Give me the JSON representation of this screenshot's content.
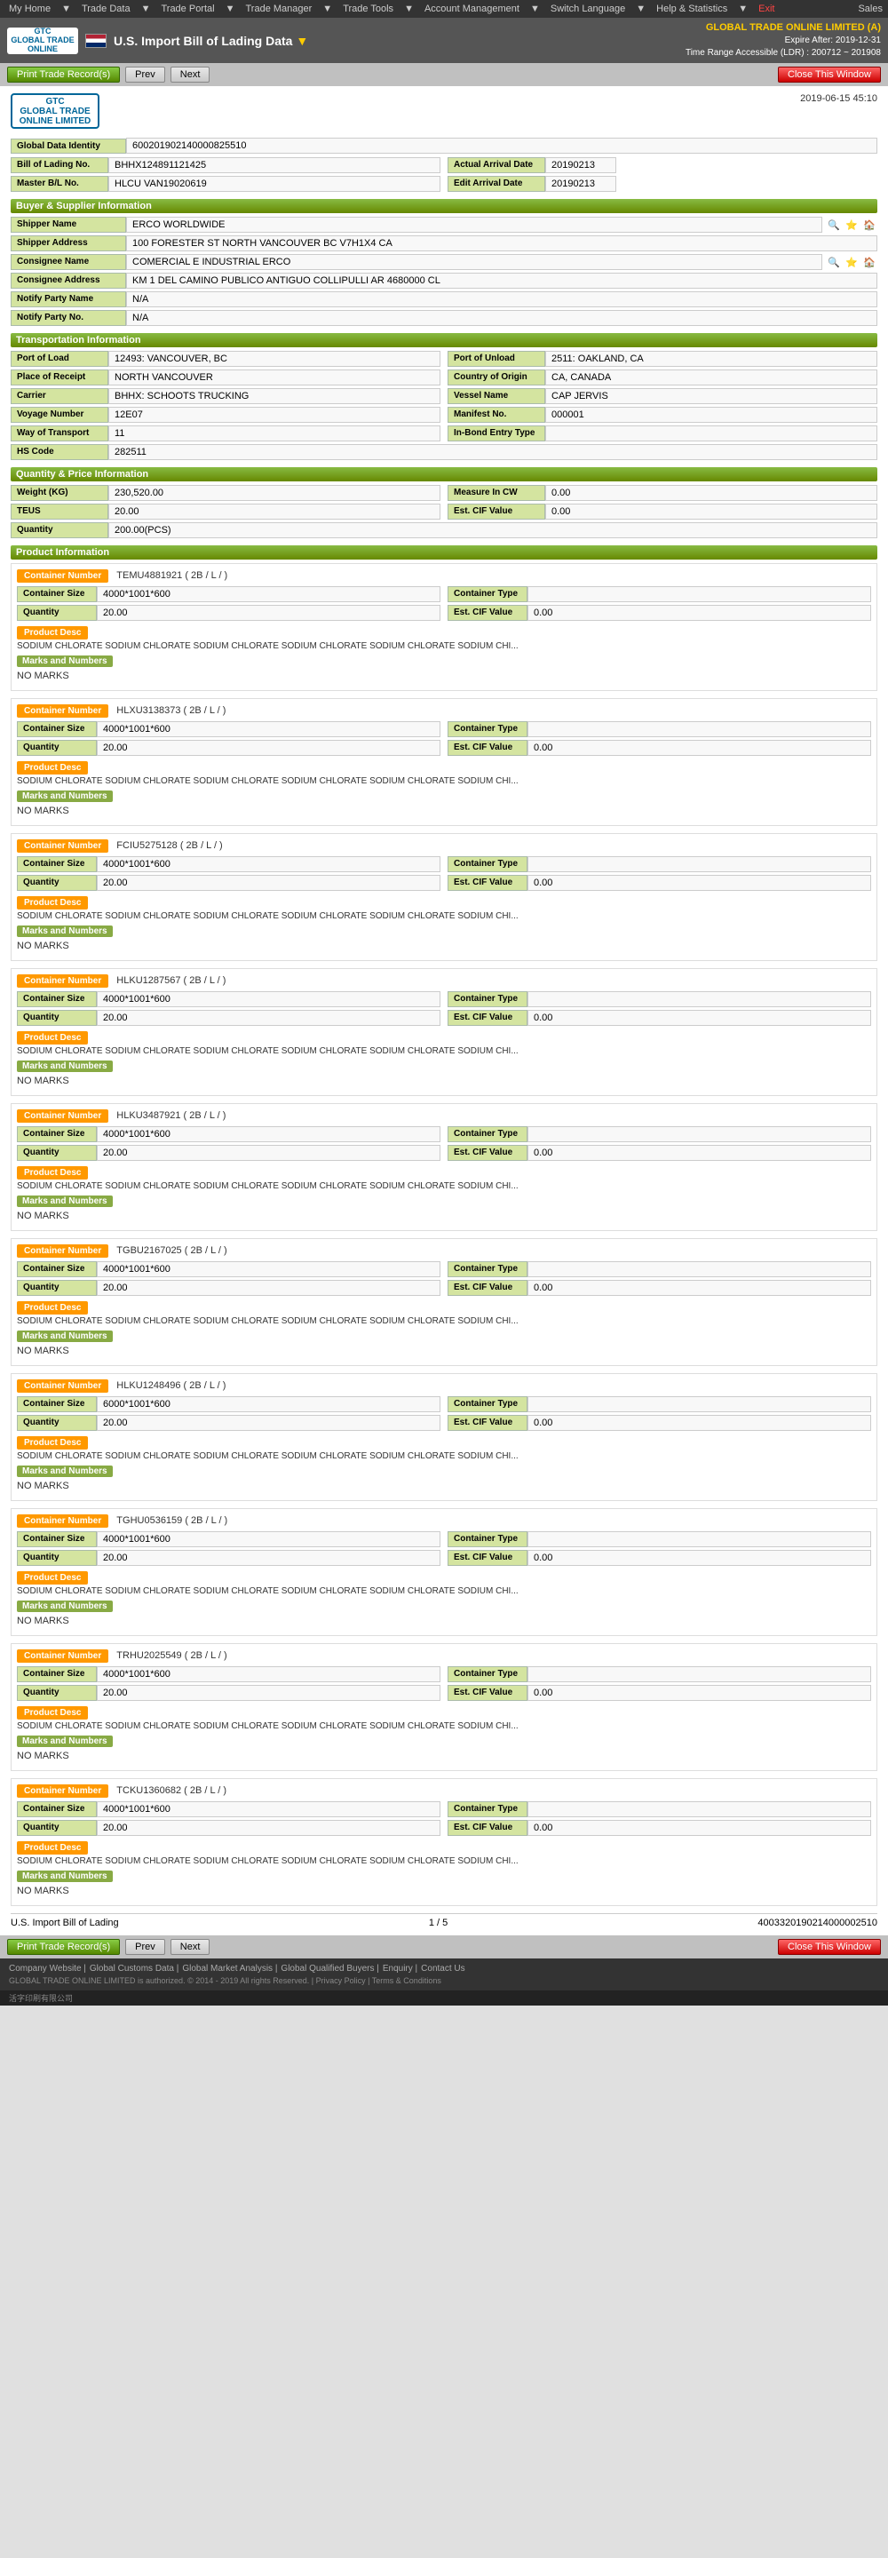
{
  "topnav": {
    "items": [
      "My Home",
      "Trade Data",
      "Trade Portal",
      "Trade Manager",
      "Trade Tools",
      "Account Management",
      "Switch Language",
      "Help & Statistics",
      "Exit"
    ],
    "sales": "Sales"
  },
  "header": {
    "logo_text": "GTC\nGLOBAL TRADE\nONLINE",
    "flag_alt": "US Flag",
    "title": "U.S. Import Bill of Lading Data",
    "company": "GLOBAL TRADE ONLINE LIMITED (A)",
    "expire": "Expire After: 2019-12-31",
    "time_range": "Time Range Accessible (LDR) : 200712 ~ 201908"
  },
  "controls": {
    "prev": "Prev",
    "next": "Next",
    "print": "Print Trade Record(s)",
    "close": "Close This Window"
  },
  "record": {
    "date": "2019-06-15 45:10",
    "global_data_id_label": "Global Data Identity",
    "global_data_id": "600201902140000825510",
    "bill_of_lading_label": "Bill of Lading No.",
    "bill_of_lading": "BHHX124891121425",
    "actual_arrival_date_label": "Actual Arrival Date",
    "actual_arrival_date": "20190213",
    "master_bol_label": "Master B/L No.",
    "master_bol": "HLCU VAN19020619",
    "edit_arrival_date_label": "Edit Arrival Date",
    "edit_arrival_date": "20190213"
  },
  "buyer_supplier": {
    "section_label": "Buyer & Supplier Information",
    "shipper_name_label": "Shipper Name",
    "shipper_name": "ERCO WORLDWIDE",
    "shipper_address_label": "Shipper Address",
    "shipper_address": "100 FORESTER ST NORTH VANCOUVER BC V7H1X4 CA",
    "consignee_label": "Consignee Name",
    "consignee": "COMERCIAL E INDUSTRIAL ERCO",
    "consignee_address_label": "Consignee Address",
    "consignee_address": "KM 1 DEL CAMINO PUBLICO ANTIGUO COLLIPULLI AR 4680000 CL",
    "notify_party_label": "Notify Party Name",
    "notify_party": "N/A",
    "notify_party2_label": "Notify Party No.",
    "notify_party2": "N/A"
  },
  "transportation": {
    "section_label": "Transportation Information",
    "port_of_load_label": "Port of Load",
    "port_of_load": "12493: VANCOUVER, BC",
    "port_of_unlaid_label": "Port of Unload",
    "port_of_unlaid": "2511: OAKLAND, CA",
    "place_of_receipt_label": "Place of Receipt",
    "place_of_receipt": "NORTH VANCOUVER",
    "country_of_origin_label": "Country of Origin",
    "country_of_origin": "CA, CANADA",
    "carrier_label": "Carrier",
    "carrier": "BHHX: SCHOOTS TRUCKING",
    "vessel_name_label": "Vessel Name",
    "vessel_name": "CAP JERVIS",
    "voyage_number_label": "Voyage Number",
    "voyage_number": "12E07",
    "manifest_no_label": "Manifest No.",
    "manifest_no": "000001",
    "way_of_transport_label": "Way of Transport",
    "way_of_transport": "11",
    "in_bond_entry_label": "In-Bond Entry Type",
    "in_bond_entry": "",
    "hs_code_label": "HS Code",
    "hs_code": "282511"
  },
  "quantity_price": {
    "section_label": "Quantity & Price Information",
    "weight_label": "Weight (KG)",
    "weight": "230,520.00",
    "measure_label": "Measure In CW",
    "measure": "0.00",
    "teus_label": "TEUS",
    "teus": "20.00",
    "est_cif_label": "Est. CIF Value",
    "est_cif": "0.00",
    "quantity_label": "Quantity",
    "quantity": "200.00(PCS)"
  },
  "product_info": {
    "section_label": "Product Information"
  },
  "containers": [
    {
      "id": "C1",
      "number_label": "Container Number",
      "number": "TEMU4881921 ( 2B / L / )",
      "size_label": "Container Size",
      "size": "4000*1001*600",
      "type_label": "Container Type",
      "type": "",
      "qty_label": "Quantity",
      "qty": "20.00",
      "est_cif_label": "Est. CIF Value",
      "est_cif": "0.00",
      "product_desc_label": "Product Desc",
      "product_desc": "SODIUM CHLORATE SODIUM CHLORATE SODIUM CHLORATE SODIUM CHLORATE SODIUM CHLORATE SODIUM CHI...",
      "marks_label": "Marks and Numbers",
      "marks": "NO MARKS"
    },
    {
      "id": "C2",
      "number_label": "Container Number",
      "number": "HLXU3138373 ( 2B / L / )",
      "size_label": "Container Size",
      "size": "4000*1001*600",
      "type_label": "Container Type",
      "type": "",
      "qty_label": "Quantity",
      "qty": "20.00",
      "est_cif_label": "Est. CIF Value",
      "est_cif": "0.00",
      "product_desc_label": "Product Desc",
      "product_desc": "SODIUM CHLORATE SODIUM CHLORATE SODIUM CHLORATE SODIUM CHLORATE SODIUM CHLORATE SODIUM CHI...",
      "marks_label": "Marks and Numbers",
      "marks": "NO MARKS"
    },
    {
      "id": "C3",
      "number_label": "Container Number",
      "number": "FCIU5275128 ( 2B / L / )",
      "size_label": "Container Size",
      "size": "4000*1001*600",
      "type_label": "Container Type",
      "type": "",
      "qty_label": "Quantity",
      "qty": "20.00",
      "est_cif_label": "Est. CIF Value",
      "est_cif": "0.00",
      "product_desc_label": "Product Desc",
      "product_desc": "SODIUM CHLORATE SODIUM CHLORATE SODIUM CHLORATE SODIUM CHLORATE SODIUM CHLORATE SODIUM CHI...",
      "marks_label": "Marks and Numbers",
      "marks": "NO MARKS"
    },
    {
      "id": "C4",
      "number_label": "Container Number",
      "number": "HLKU1287567 ( 2B / L / )",
      "size_label": "Container Size",
      "size": "4000*1001*600",
      "type_label": "Container Type",
      "type": "",
      "qty_label": "Quantity",
      "qty": "20.00",
      "est_cif_label": "Est. CIF Value",
      "est_cif": "0.00",
      "product_desc_label": "Product Desc",
      "product_desc": "SODIUM CHLORATE SODIUM CHLORATE SODIUM CHLORATE SODIUM CHLORATE SODIUM CHLORATE SODIUM CHI...",
      "marks_label": "Marks and Numbers",
      "marks": "NO MARKS"
    },
    {
      "id": "C5",
      "number_label": "Container Number",
      "number": "HLKU3487921 ( 2B / L / )",
      "size_label": "Container Size",
      "size": "4000*1001*600",
      "type_label": "Container Type",
      "type": "",
      "qty_label": "Quantity",
      "qty": "20.00",
      "est_cif_label": "Est. CIF Value",
      "est_cif": "0.00",
      "product_desc_label": "Product Desc",
      "product_desc": "SODIUM CHLORATE SODIUM CHLORATE SODIUM CHLORATE SODIUM CHLORATE SODIUM CHLORATE SODIUM CHI...",
      "marks_label": "Marks and Numbers",
      "marks": "NO MARKS"
    },
    {
      "id": "C6",
      "number_label": "Container Number",
      "number": "TGBU2167025 ( 2B / L / )",
      "size_label": "Container Size",
      "size": "4000*1001*600",
      "type_label": "Container Type",
      "type": "",
      "qty_label": "Quantity",
      "qty": "20.00",
      "est_cif_label": "Est. CIF Value",
      "est_cif": "0.00",
      "product_desc_label": "Product Desc",
      "product_desc": "SODIUM CHLORATE SODIUM CHLORATE SODIUM CHLORATE SODIUM CHLORATE SODIUM CHLORATE SODIUM CHI...",
      "marks_label": "Marks and Numbers",
      "marks": "NO MARKS"
    },
    {
      "id": "C7",
      "number_label": "Container Number",
      "number": "HLKU1248496 ( 2B / L / )",
      "size_label": "Container Size",
      "size": "6000*1001*600",
      "type_label": "Container Type",
      "type": "",
      "qty_label": "Quantity",
      "qty": "20.00",
      "est_cif_label": "Est. CIF Value",
      "est_cif": "0.00",
      "product_desc_label": "Product Desc",
      "product_desc": "SODIUM CHLORATE SODIUM CHLORATE SODIUM CHLORATE SODIUM CHLORATE SODIUM CHLORATE SODIUM CHI...",
      "marks_label": "Marks and Numbers",
      "marks": "NO MARKS"
    },
    {
      "id": "C8",
      "number_label": "Container Number",
      "number": "TGHU0536159 ( 2B / L / )",
      "size_label": "Container Size",
      "size": "4000*1001*600",
      "type_label": "Container Type",
      "type": "",
      "qty_label": "Quantity",
      "qty": "20.00",
      "est_cif_label": "Est. CIF Value",
      "est_cif": "0.00",
      "product_desc_label": "Product Desc",
      "product_desc": "SODIUM CHLORATE SODIUM CHLORATE SODIUM CHLORATE SODIUM CHLORATE SODIUM CHLORATE SODIUM CHI...",
      "marks_label": "Marks and Numbers",
      "marks": "NO MARKS"
    },
    {
      "id": "C9",
      "number_label": "Container Number",
      "number": "TRHU2025549 ( 2B / L / )",
      "size_label": "Container Size",
      "size": "4000*1001*600",
      "type_label": "Container Type",
      "type": "",
      "qty_label": "Quantity",
      "qty": "20.00",
      "est_cif_label": "Est. CIF Value",
      "est_cif": "0.00",
      "product_desc_label": "Product Desc",
      "product_desc": "SODIUM CHLORATE SODIUM CHLORATE SODIUM CHLORATE SODIUM CHLORATE SODIUM CHLORATE SODIUM CHI...",
      "marks_label": "Marks and Numbers",
      "marks": "NO MARKS"
    },
    {
      "id": "C10",
      "number_label": "Container Number",
      "number": "TCKU1360682 ( 2B / L / )",
      "size_label": "Container Size",
      "size": "4000*1001*600",
      "type_label": "Container Type",
      "type": "",
      "qty_label": "Quantity",
      "qty": "20.00",
      "est_cif_label": "Est. CIF Value",
      "est_cif": "0.00",
      "product_desc_label": "Product Desc",
      "product_desc": "SODIUM CHLORATE SODIUM CHLORATE SODIUM CHLORATE SODIUM CHLORATE SODIUM CHLORATE SODIUM CHI...",
      "marks_label": "Marks and Numbers",
      "marks": "NO MARKS"
    }
  ],
  "page_bottom": {
    "source": "U.S. Import Bill of Lading",
    "page_info": "1 / 5",
    "record_id": "4003320190214000002510"
  },
  "footer": {
    "links": [
      "Company Website",
      "Global Customs Data",
      "Global Market Analysis",
      "Global Qualified Buyers",
      "Enquiry",
      "Contact Us"
    ],
    "copyright": "GLOBAL TRADE ONLINE LIMITED is authorized. © 2014 - 2019 All rights Reserved. | Privacy Policy | Terms & Conditions"
  },
  "bottom_bar": {
    "text": "活字印刷有限公司"
  }
}
